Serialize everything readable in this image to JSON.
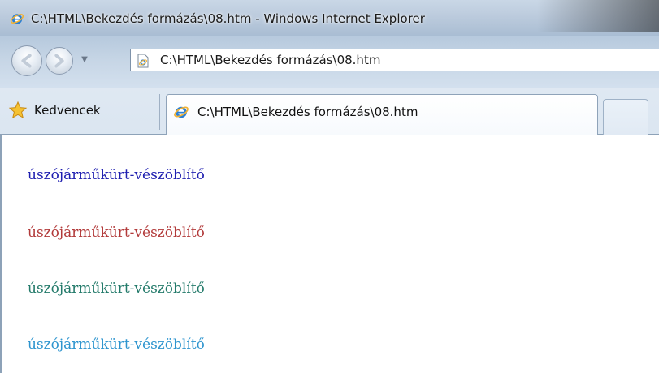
{
  "window": {
    "title": "C:\\HTML\\Bekezdés formázás\\08.htm - Windows Internet Explorer"
  },
  "navigation": {
    "back_icon": "back-arrow-icon",
    "forward_icon": "forward-arrow-icon",
    "dropdown_icon": "chevron-down-icon",
    "address": "C:\\HTML\\Bekezdés formázás\\08.htm"
  },
  "favorites": {
    "label": "Kedvencek",
    "icon": "star-icon"
  },
  "tabs": [
    {
      "label": "C:\\HTML\\Bekezdés formázás\\08.htm",
      "icon": "ie-icon"
    }
  ],
  "content": {
    "paragraphs": [
      {
        "text": "úszójárműkürt-vészöblítő",
        "color": "#1f1fb0"
      },
      {
        "text": "úszójárműkürt-vészöblítő",
        "color": "#b23a3a"
      },
      {
        "text": "úszójárműkürt-vészöblítő",
        "color": "#237a6a"
      },
      {
        "text": "úszójárműkürt-vészöblítő",
        "color": "#2e95cf"
      }
    ]
  },
  "colors": {
    "ie_blue": "#2a7fd4",
    "ie_ring": "#f2b234"
  }
}
